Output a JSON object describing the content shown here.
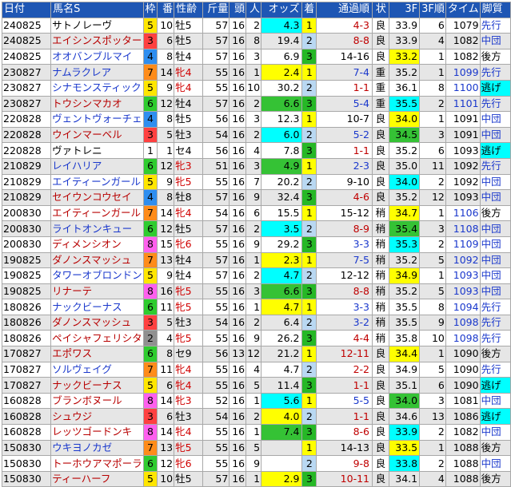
{
  "headers": {
    "date": "日付",
    "horse": "馬名S",
    "waku": "枠",
    "ban": "番",
    "sex_age": "性齢",
    "kinryo": "斤量",
    "tosu": "頭",
    "ninki": "人",
    "odds": "オッズ",
    "chakujun": "着",
    "passing": "通過順",
    "condition": "状",
    "last3f": "3F",
    "last3f_rank": "3F順",
    "time": "タイム",
    "style": "脚質"
  },
  "rows": [
    {
      "date": "240825",
      "horse": "サトノレーヴ",
      "horse_color": "black",
      "waku": "5",
      "ban": "10",
      "sex_age": "牡5",
      "sex_red": false,
      "kinryo": "57",
      "tosu": "16",
      "ninki": "2",
      "odds": "4.3",
      "odds_hl": "cyan",
      "chakujun": "1",
      "passing": "4-3",
      "passing_color": "red",
      "condition": "良",
      "last3f": "33.9",
      "last3f_hl": "",
      "last3f_rank": "6",
      "time": "1079",
      "time_blue": false,
      "style": "先行",
      "style_blue": true,
      "style_hl": false
    },
    {
      "date": "240825",
      "horse": "エイシンスポッター",
      "horse_color": "red",
      "waku": "3",
      "ban": "6",
      "sex_age": "牡5",
      "sex_red": false,
      "kinryo": "57",
      "tosu": "16",
      "ninki": "8",
      "odds": "19.4",
      "odds_hl": "",
      "chakujun": "2",
      "passing": "8-8",
      "passing_color": "red",
      "condition": "良",
      "last3f": "33.9",
      "last3f_hl": "",
      "last3f_rank": "4",
      "time": "1082",
      "time_blue": false,
      "style": "中団",
      "style_blue": true,
      "style_hl": false
    },
    {
      "date": "240825",
      "horse": "オオバンブルマイ",
      "horse_color": "blue",
      "waku": "4",
      "ban": "8",
      "sex_age": "牡4",
      "sex_red": false,
      "kinryo": "57",
      "tosu": "16",
      "ninki": "3",
      "odds": "6.9",
      "odds_hl": "",
      "chakujun": "3",
      "passing": "14-16",
      "passing_color": "black",
      "condition": "良",
      "last3f": "33.2",
      "last3f_hl": "yellow",
      "last3f_rank": "1",
      "time": "1082",
      "time_blue": false,
      "style": "後方",
      "style_blue": false,
      "style_hl": false
    },
    {
      "date": "230827",
      "horse": "ナムラクレア",
      "horse_color": "blue",
      "waku": "7",
      "ban": "14",
      "sex_age": "牝4",
      "sex_red": true,
      "kinryo": "55",
      "tosu": "16",
      "ninki": "1",
      "odds": "2.4",
      "odds_hl": "yellow",
      "chakujun": "1",
      "passing": "7-4",
      "passing_color": "blue",
      "condition": "重",
      "last3f": "35.2",
      "last3f_hl": "",
      "last3f_rank": "1",
      "time": "1099",
      "time_blue": true,
      "style": "先行",
      "style_blue": true,
      "style_hl": false
    },
    {
      "date": "230827",
      "horse": "シナモンスティック",
      "horse_color": "blue",
      "waku": "5",
      "ban": "9",
      "sex_age": "牝4",
      "sex_red": true,
      "kinryo": "55",
      "tosu": "16",
      "ninki": "10",
      "odds": "30.2",
      "odds_hl": "",
      "chakujun": "2",
      "passing": "1-1",
      "passing_color": "red",
      "condition": "重",
      "last3f": "36.1",
      "last3f_hl": "",
      "last3f_rank": "8",
      "time": "1100",
      "time_blue": true,
      "style": "逃げ",
      "style_blue": false,
      "style_hl": true
    },
    {
      "date": "230827",
      "horse": "トウシンマカオ",
      "horse_color": "red",
      "waku": "6",
      "ban": "12",
      "sex_age": "牡4",
      "sex_red": false,
      "kinryo": "57",
      "tosu": "16",
      "ninki": "2",
      "odds": "6.6",
      "odds_hl": "green",
      "chakujun": "3",
      "passing": "5-4",
      "passing_color": "blue",
      "condition": "重",
      "last3f": "35.5",
      "last3f_hl": "cyan",
      "last3f_rank": "2",
      "time": "1101",
      "time_blue": true,
      "style": "先行",
      "style_blue": true,
      "style_hl": false
    },
    {
      "date": "220828",
      "horse": "ヴェントヴォーチェ",
      "horse_color": "blue",
      "waku": "4",
      "ban": "8",
      "sex_age": "牡5",
      "sex_red": false,
      "kinryo": "56",
      "tosu": "16",
      "ninki": "3",
      "odds": "12.3",
      "odds_hl": "",
      "chakujun": "1",
      "passing": "10-7",
      "passing_color": "black",
      "condition": "良",
      "last3f": "34.0",
      "last3f_hl": "yellow",
      "last3f_rank": "1",
      "time": "1091",
      "time_blue": false,
      "style": "中団",
      "style_blue": true,
      "style_hl": false
    },
    {
      "date": "220828",
      "horse": "ウインマーベル",
      "horse_color": "red",
      "waku": "3",
      "ban": "5",
      "sex_age": "牡3",
      "sex_red": false,
      "kinryo": "54",
      "tosu": "16",
      "ninki": "2",
      "odds": "6.0",
      "odds_hl": "cyan",
      "chakujun": "2",
      "passing": "5-2",
      "passing_color": "blue",
      "condition": "良",
      "last3f": "34.5",
      "last3f_hl": "green",
      "last3f_rank": "3",
      "time": "1091",
      "time_blue": false,
      "style": "中団",
      "style_blue": true,
      "style_hl": false
    },
    {
      "date": "220828",
      "horse": "ヴァトレニ",
      "horse_color": "black",
      "waku": "1",
      "ban": "1",
      "sex_age": "セ4",
      "sex_red": false,
      "kinryo": "56",
      "tosu": "16",
      "ninki": "4",
      "odds": "7.8",
      "odds_hl": "",
      "chakujun": "3",
      "passing": "1-1",
      "passing_color": "red",
      "condition": "良",
      "last3f": "35.2",
      "last3f_hl": "",
      "last3f_rank": "6",
      "time": "1093",
      "time_blue": false,
      "style": "逃げ",
      "style_blue": false,
      "style_hl": true
    },
    {
      "date": "210829",
      "horse": "レイハリア",
      "horse_color": "blue",
      "waku": "6",
      "ban": "12",
      "sex_age": "牝3",
      "sex_red": true,
      "kinryo": "51",
      "tosu": "16",
      "ninki": "3",
      "odds": "4.9",
      "odds_hl": "green",
      "chakujun": "1",
      "passing": "2-3",
      "passing_color": "blue",
      "condition": "良",
      "last3f": "35.0",
      "last3f_hl": "",
      "last3f_rank": "11",
      "time": "1092",
      "time_blue": false,
      "style": "先行",
      "style_blue": true,
      "style_hl": false
    },
    {
      "date": "210829",
      "horse": "エイティーンガール",
      "horse_color": "blue",
      "waku": "5",
      "ban": "9",
      "sex_age": "牝5",
      "sex_red": true,
      "kinryo": "55",
      "tosu": "16",
      "ninki": "7",
      "odds": "20.2",
      "odds_hl": "",
      "chakujun": "2",
      "passing": "9-10",
      "passing_color": "black",
      "condition": "良",
      "last3f": "34.0",
      "last3f_hl": "cyan",
      "last3f_rank": "2",
      "time": "1092",
      "time_blue": false,
      "style": "中団",
      "style_blue": true,
      "style_hl": false
    },
    {
      "date": "210829",
      "horse": "セイウンコウセイ",
      "horse_color": "red",
      "waku": "4",
      "ban": "8",
      "sex_age": "牡8",
      "sex_red": false,
      "kinryo": "57",
      "tosu": "16",
      "ninki": "9",
      "odds": "32.4",
      "odds_hl": "",
      "chakujun": "3",
      "passing": "4-6",
      "passing_color": "red",
      "condition": "良",
      "last3f": "35.2",
      "last3f_hl": "",
      "last3f_rank": "12",
      "time": "1093",
      "time_blue": false,
      "style": "中団",
      "style_blue": true,
      "style_hl": false
    },
    {
      "date": "200830",
      "horse": "エイティーンガール",
      "horse_color": "red",
      "waku": "7",
      "ban": "14",
      "sex_age": "牝4",
      "sex_red": true,
      "kinryo": "54",
      "tosu": "16",
      "ninki": "6",
      "odds": "15.5",
      "odds_hl": "",
      "chakujun": "1",
      "passing": "15-12",
      "passing_color": "black",
      "condition": "稍",
      "last3f": "34.7",
      "last3f_hl": "yellow",
      "last3f_rank": "1",
      "time": "1106",
      "time_blue": true,
      "style": "後方",
      "style_blue": false,
      "style_hl": false
    },
    {
      "date": "200830",
      "horse": "ライトオンキュー",
      "horse_color": "blue",
      "waku": "6",
      "ban": "12",
      "sex_age": "牡5",
      "sex_red": false,
      "kinryo": "57",
      "tosu": "16",
      "ninki": "2",
      "odds": "3.5",
      "odds_hl": "cyan",
      "chakujun": "2",
      "passing": "8-9",
      "passing_color": "red",
      "condition": "稍",
      "last3f": "35.4",
      "last3f_hl": "green",
      "last3f_rank": "3",
      "time": "1108",
      "time_blue": true,
      "style": "中団",
      "style_blue": true,
      "style_hl": false
    },
    {
      "date": "200830",
      "horse": "ディメンシオン",
      "horse_color": "red",
      "waku": "8",
      "ban": "15",
      "sex_age": "牝6",
      "sex_red": true,
      "kinryo": "55",
      "tosu": "16",
      "ninki": "9",
      "odds": "29.2",
      "odds_hl": "",
      "chakujun": "3",
      "passing": "3-3",
      "passing_color": "blue",
      "condition": "稍",
      "last3f": "35.3",
      "last3f_hl": "cyan",
      "last3f_rank": "2",
      "time": "1109",
      "time_blue": true,
      "style": "中団",
      "style_blue": true,
      "style_hl": false
    },
    {
      "date": "190825",
      "horse": "ダノンスマッシュ",
      "horse_color": "red",
      "waku": "7",
      "ban": "13",
      "sex_age": "牡4",
      "sex_red": false,
      "kinryo": "57",
      "tosu": "16",
      "ninki": "1",
      "odds": "2.3",
      "odds_hl": "yellow",
      "chakujun": "1",
      "passing": "7-5",
      "passing_color": "blue",
      "condition": "稍",
      "last3f": "35.2",
      "last3f_hl": "",
      "last3f_rank": "5",
      "time": "1092",
      "time_blue": true,
      "style": "中団",
      "style_blue": true,
      "style_hl": false
    },
    {
      "date": "190825",
      "horse": "タワーオブロンドン",
      "horse_color": "blue",
      "waku": "5",
      "ban": "9",
      "sex_age": "牡4",
      "sex_red": false,
      "kinryo": "57",
      "tosu": "16",
      "ninki": "2",
      "odds": "4.7",
      "odds_hl": "cyan",
      "chakujun": "2",
      "passing": "12-12",
      "passing_color": "black",
      "condition": "稍",
      "last3f": "34.9",
      "last3f_hl": "yellow",
      "last3f_rank": "1",
      "time": "1093",
      "time_blue": true,
      "style": "中団",
      "style_blue": true,
      "style_hl": false
    },
    {
      "date": "190825",
      "horse": "リナーテ",
      "horse_color": "red",
      "waku": "8",
      "ban": "16",
      "sex_age": "牝5",
      "sex_red": true,
      "kinryo": "55",
      "tosu": "16",
      "ninki": "3",
      "odds": "6.6",
      "odds_hl": "green",
      "chakujun": "3",
      "passing": "8-8",
      "passing_color": "red",
      "condition": "稍",
      "last3f": "35.2",
      "last3f_hl": "",
      "last3f_rank": "5",
      "time": "1093",
      "time_blue": true,
      "style": "中団",
      "style_blue": true,
      "style_hl": false
    },
    {
      "date": "180826",
      "horse": "ナックビーナス",
      "horse_color": "blue",
      "waku": "6",
      "ban": "11",
      "sex_age": "牝5",
      "sex_red": true,
      "kinryo": "55",
      "tosu": "16",
      "ninki": "1",
      "odds": "4.7",
      "odds_hl": "yellow",
      "chakujun": "1",
      "passing": "3-3",
      "passing_color": "blue",
      "condition": "稍",
      "last3f": "35.5",
      "last3f_hl": "",
      "last3f_rank": "8",
      "time": "1094",
      "time_blue": true,
      "style": "先行",
      "style_blue": true,
      "style_hl": false
    },
    {
      "date": "180826",
      "horse": "ダノンスマッシュ",
      "horse_color": "red",
      "waku": "3",
      "ban": "5",
      "sex_age": "牡3",
      "sex_red": false,
      "kinryo": "54",
      "tosu": "16",
      "ninki": "2",
      "odds": "6.4",
      "odds_hl": "",
      "chakujun": "2",
      "passing": "3-2",
      "passing_color": "blue",
      "condition": "稍",
      "last3f": "35.5",
      "last3f_hl": "",
      "last3f_rank": "9",
      "time": "1098",
      "time_blue": true,
      "style": "先行",
      "style_blue": true,
      "style_hl": false
    },
    {
      "date": "180826",
      "horse": "ペイシャフェリシタ",
      "horse_color": "red",
      "waku": "2",
      "ban": "4",
      "sex_age": "牝5",
      "sex_red": true,
      "kinryo": "55",
      "tosu": "16",
      "ninki": "9",
      "odds": "26.2",
      "odds_hl": "",
      "chakujun": "3",
      "passing": "4-4",
      "passing_color": "red",
      "condition": "稍",
      "last3f": "35.8",
      "last3f_hl": "",
      "last3f_rank": "10",
      "time": "1098",
      "time_blue": true,
      "style": "先行",
      "style_blue": true,
      "style_hl": false
    },
    {
      "date": "170827",
      "horse": "エポワス",
      "horse_color": "red",
      "waku": "6",
      "ban": "8",
      "sex_age": "セ9",
      "sex_red": false,
      "kinryo": "56",
      "tosu": "13",
      "ninki": "12",
      "odds": "21.2",
      "odds_hl": "",
      "chakujun": "1",
      "passing": "12-11",
      "passing_color": "red",
      "condition": "良",
      "last3f": "34.4",
      "last3f_hl": "yellow",
      "last3f_rank": "1",
      "time": "1090",
      "time_blue": false,
      "style": "後方",
      "style_blue": false,
      "style_hl": false
    },
    {
      "date": "170827",
      "horse": "ソルヴェイグ",
      "horse_color": "blue",
      "waku": "7",
      "ban": "11",
      "sex_age": "牝4",
      "sex_red": true,
      "kinryo": "55",
      "tosu": "16",
      "ninki": "4",
      "odds": "4.7",
      "odds_hl": "",
      "chakujun": "2",
      "passing": "2-2",
      "passing_color": "red",
      "condition": "良",
      "last3f": "34.9",
      "last3f_hl": "",
      "last3f_rank": "5",
      "time": "1090",
      "time_blue": false,
      "style": "先行",
      "style_blue": true,
      "style_hl": false
    },
    {
      "date": "170827",
      "horse": "ナックビーナス",
      "horse_color": "red",
      "waku": "5",
      "ban": "6",
      "sex_age": "牝4",
      "sex_red": true,
      "kinryo": "55",
      "tosu": "16",
      "ninki": "5",
      "odds": "11.4",
      "odds_hl": "",
      "chakujun": "3",
      "passing": "1-1",
      "passing_color": "red",
      "condition": "良",
      "last3f": "35.1",
      "last3f_hl": "",
      "last3f_rank": "6",
      "time": "1090",
      "time_blue": false,
      "style": "逃げ",
      "style_blue": false,
      "style_hl": true
    },
    {
      "date": "160828",
      "horse": "ブランボヌール",
      "horse_color": "red",
      "waku": "8",
      "ban": "14",
      "sex_age": "牝3",
      "sex_red": true,
      "kinryo": "52",
      "tosu": "16",
      "ninki": "1",
      "odds": "5.6",
      "odds_hl": "cyan",
      "chakujun": "1",
      "passing": "5-5",
      "passing_color": "blue",
      "condition": "良",
      "last3f": "34.0",
      "last3f_hl": "green",
      "last3f_rank": "3",
      "time": "1081",
      "time_blue": false,
      "style": "中団",
      "style_blue": true,
      "style_hl": false
    },
    {
      "date": "160828",
      "horse": "シュウジ",
      "horse_color": "red",
      "waku": "3",
      "ban": "6",
      "sex_age": "牡3",
      "sex_red": false,
      "kinryo": "54",
      "tosu": "16",
      "ninki": "2",
      "odds": "4.0",
      "odds_hl": "yellow",
      "chakujun": "2",
      "passing": "1-1",
      "passing_color": "red",
      "condition": "良",
      "last3f": "34.6",
      "last3f_hl": "",
      "last3f_rank": "13",
      "time": "1086",
      "time_blue": false,
      "style": "逃げ",
      "style_blue": false,
      "style_hl": true
    },
    {
      "date": "160828",
      "horse": "レッツゴードンキ",
      "horse_color": "red",
      "waku": "8",
      "ban": "14",
      "sex_age": "牝4",
      "sex_red": true,
      "kinryo": "55",
      "tosu": "16",
      "ninki": "1",
      "odds": "7.4",
      "odds_hl": "green",
      "chakujun": "3",
      "passing": "8-6",
      "passing_color": "red",
      "condition": "良",
      "last3f": "33.9",
      "last3f_hl": "cyan",
      "last3f_rank": "2",
      "time": "1082",
      "time_blue": false,
      "style": "中団",
      "style_blue": true,
      "style_hl": false
    },
    {
      "date": "150830",
      "horse": "ウキヨノカゼ",
      "horse_color": "blue",
      "waku": "7",
      "ban": "13",
      "sex_age": "牝5",
      "sex_red": true,
      "kinryo": "55",
      "tosu": "16",
      "ninki": "5",
      "odds": "",
      "odds_hl": "",
      "chakujun": "1",
      "passing": "14-13",
      "passing_color": "black",
      "condition": "良",
      "last3f": "33.5",
      "last3f_hl": "yellow",
      "last3f_rank": "1",
      "time": "1088",
      "time_blue": false,
      "style": "後方",
      "style_blue": false,
      "style_hl": false
    },
    {
      "date": "150830",
      "horse": "トーホウアマポーラ",
      "horse_color": "red",
      "waku": "6",
      "ban": "12",
      "sex_age": "牝6",
      "sex_red": true,
      "kinryo": "55",
      "tosu": "16",
      "ninki": "9",
      "odds": "",
      "odds_hl": "",
      "chakujun": "2",
      "passing": "9-8",
      "passing_color": "red",
      "condition": "良",
      "last3f": "33.8",
      "last3f_hl": "cyan",
      "last3f_rank": "2",
      "time": "1088",
      "time_blue": false,
      "style": "中団",
      "style_blue": true,
      "style_hl": false
    },
    {
      "date": "150830",
      "horse": "ティーハーフ",
      "horse_color": "red",
      "waku": "5",
      "ban": "10",
      "sex_age": "牡5",
      "sex_red": false,
      "kinryo": "57",
      "tosu": "16",
      "ninki": "1",
      "odds": "2.9",
      "odds_hl": "yellow",
      "chakujun": "3",
      "passing": "10-11",
      "passing_color": "red",
      "condition": "良",
      "last3f": "34.1",
      "last3f_hl": "",
      "last3f_rank": "4",
      "time": "1088",
      "time_blue": false,
      "style": "後方",
      "style_blue": false,
      "style_hl": false
    }
  ]
}
